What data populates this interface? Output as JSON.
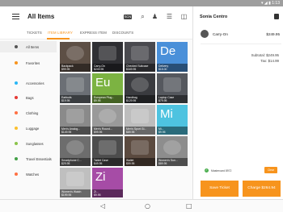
{
  "app": {
    "title": "All Items"
  },
  "toolbar": {
    "scan_label": "SCN"
  },
  "tabs": [
    {
      "label": "TICKETS"
    },
    {
      "label": "ITEM LIBRARY"
    },
    {
      "label": "EXPRESS ITEM"
    },
    {
      "label": "DISCOUNTS"
    }
  ],
  "categories": [
    {
      "label": "All Items",
      "color": "#555555"
    },
    {
      "label": "Favorites",
      "color": "#f7941d"
    },
    {
      "label": "Accessories",
      "color": "#29b6f6"
    },
    {
      "label": "Bags",
      "color": "#e53935"
    },
    {
      "label": "Clothing",
      "color": "#ff7043"
    },
    {
      "label": "Luggage",
      "color": "#fbc02d"
    },
    {
      "label": "Sunglasses",
      "color": "#8bc34a"
    },
    {
      "label": "Travel Essentials",
      "color": "#43a047"
    },
    {
      "label": "Watches",
      "color": "#ff7043"
    }
  ],
  "tiles": [
    {
      "name": "Backpack",
      "price": "$99.95",
      "abbr": "",
      "color": "#5d4f45"
    },
    {
      "name": "Carry-On",
      "price": "$249.95",
      "abbr": "",
      "color": "#2f2f33"
    },
    {
      "name": "Checked Suitcase",
      "price": "$349.95",
      "abbr": "",
      "color": "#4a4a4f"
    },
    {
      "name": "Delivery",
      "price": "$15.00",
      "abbr": "De",
      "color": "#4a90d9"
    },
    {
      "name": "Earbuds",
      "price": "$19.95",
      "abbr": "",
      "color": "#6b6f75"
    },
    {
      "name": "European Plug...",
      "price": "$9.95",
      "abbr": "Eu",
      "color": "#7cb342"
    },
    {
      "name": "Handbag",
      "price": "$129.95",
      "abbr": "",
      "color": "#3a3b3f"
    },
    {
      "name": "Laptop Case",
      "price": "$79.95",
      "abbr": "",
      "color": "#55585e"
    },
    {
      "name": "Men's Analog...",
      "price": "$149.95",
      "abbr": "",
      "color": "#8a8a8a"
    },
    {
      "name": "Men's Round...",
      "price": "$99.95",
      "abbr": "",
      "color": "#9a9a9a"
    },
    {
      "name": "Men's Sport Gl...",
      "price": "$89.95",
      "abbr": "",
      "color": "#bdbdbd"
    },
    {
      "name": "Mi...",
      "price": "$9.95",
      "abbr": "Mi",
      "color": "#4ec3e0"
    },
    {
      "name": "Smartphone C...",
      "price": "$29.95",
      "abbr": "",
      "color": "#6d6d6d"
    },
    {
      "name": "Tablet Case",
      "price": "$49.95",
      "abbr": "",
      "color": "#4d4d4d"
    },
    {
      "name": "Wallet",
      "price": "$59.95",
      "abbr": "",
      "color": "#5b4a3f"
    },
    {
      "name": "Women's Sun...",
      "price": "$89.95",
      "abbr": "",
      "color": "#8d8d8d"
    },
    {
      "name": "Women's Watch",
      "price": "$199.95",
      "abbr": "",
      "color": "#bfbfbf"
    },
    {
      "name": "Zi...",
      "price": "$9.95",
      "abbr": "Zi",
      "color": "#a64ca6"
    }
  ],
  "ticket": {
    "customer": "Sonia Centro",
    "item_name": "Carry-On",
    "item_price": "$249.95",
    "subtotal": "Subtotal: $249.95",
    "tax": "Tax: $14.99",
    "payment_label": "Mastercard 8972",
    "clear_label": "Clear",
    "save_label": "Save Ticket",
    "charge_label": "Charge $264.94"
  },
  "nav": {
    "back": "◁",
    "home": "○",
    "recent": "□"
  },
  "status": {
    "icons": "▾ ◢ ▮ 1:13"
  }
}
